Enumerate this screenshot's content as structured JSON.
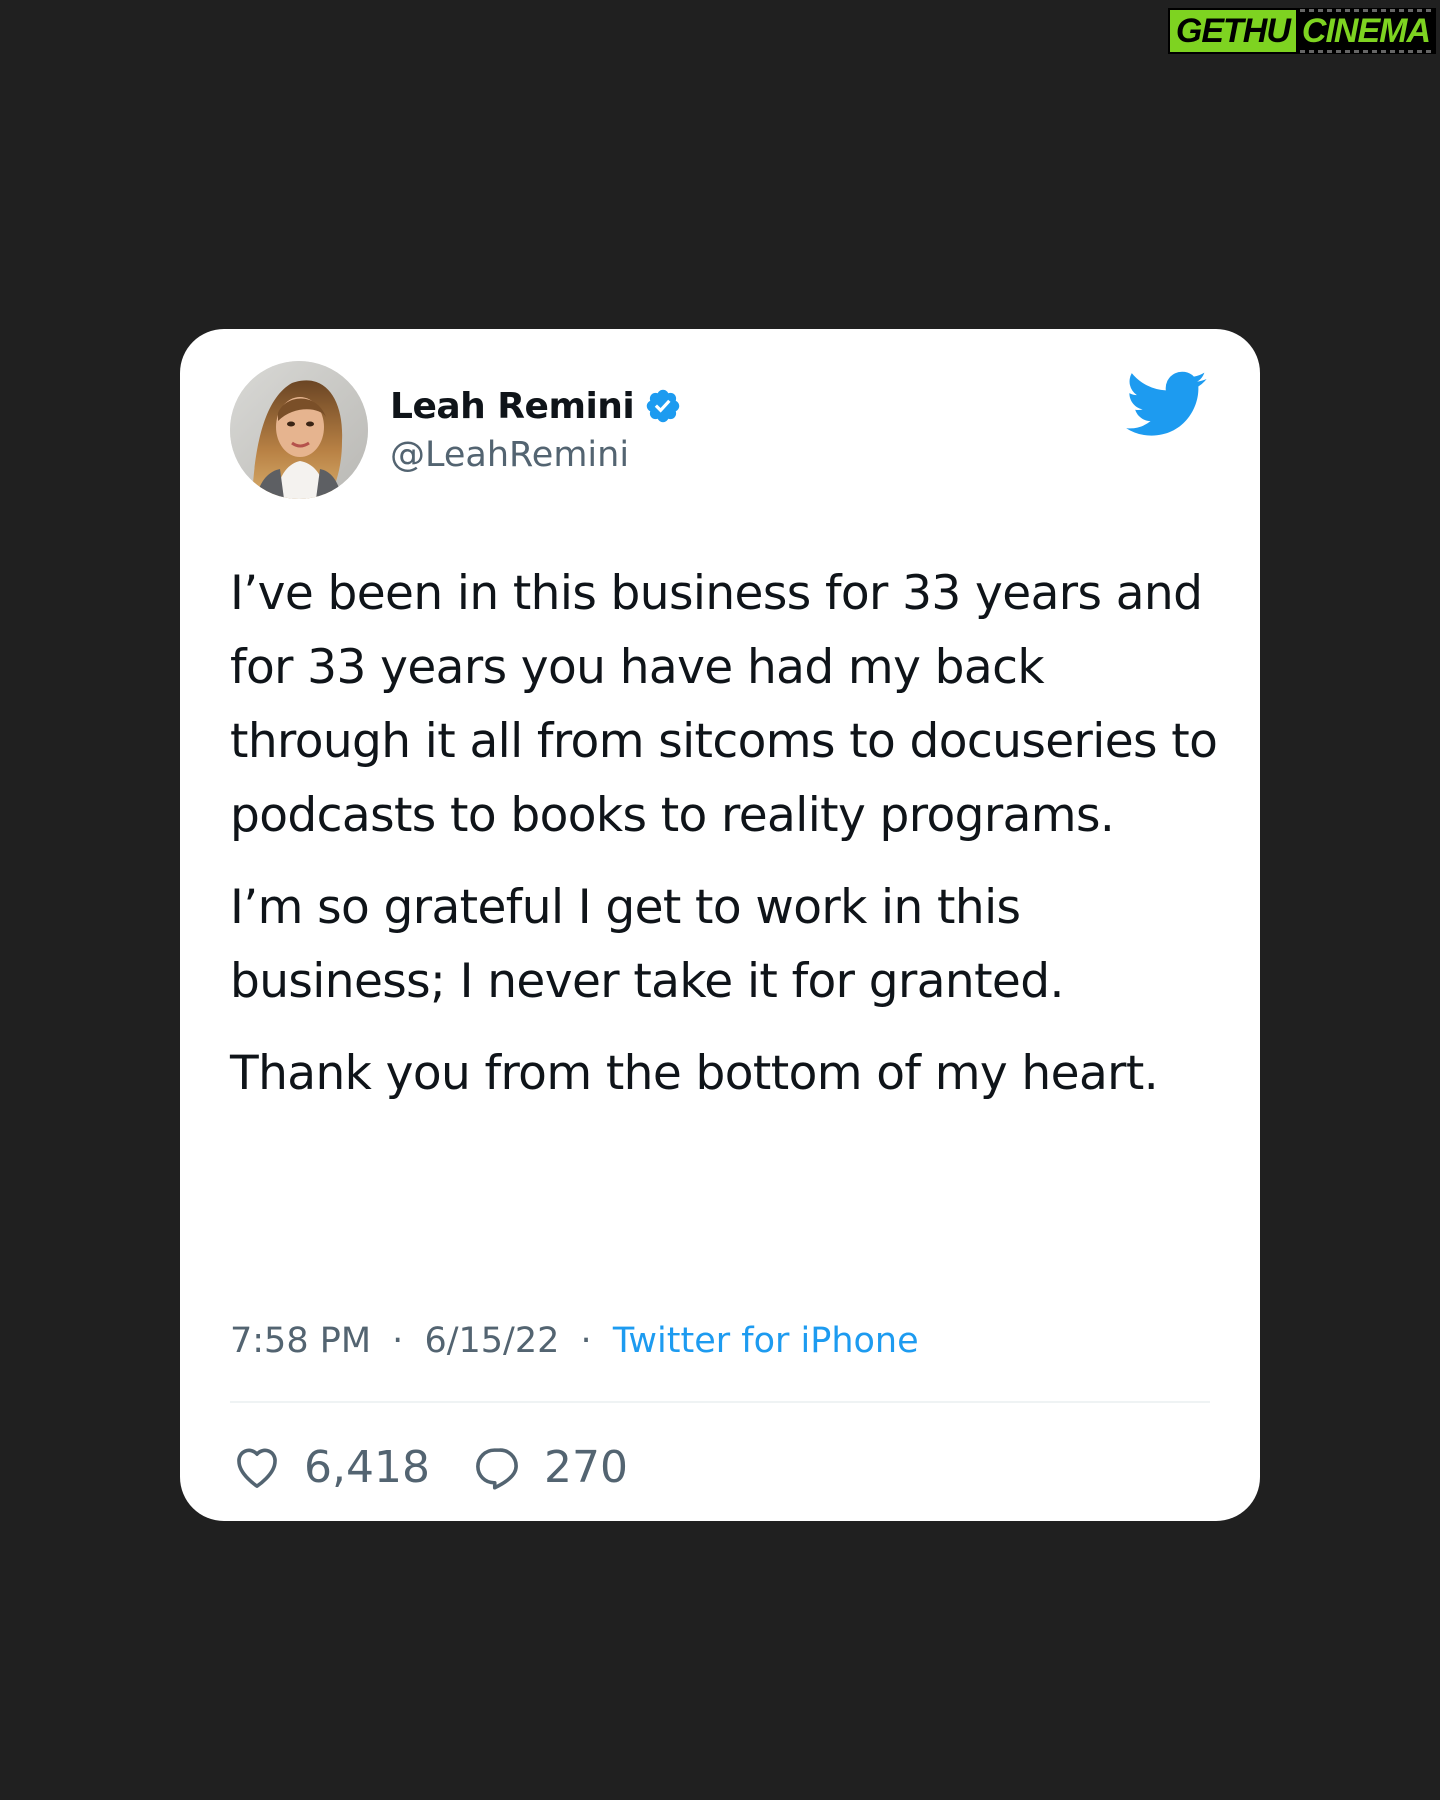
{
  "watermark": {
    "part1": "GETHU",
    "part2": "CINEMA"
  },
  "tweet": {
    "display_name": "Leah Remini",
    "handle": "@LeahRemini",
    "verified": true,
    "body": [
      "I’ve been in this business for 33 years and for 33 years you have had my back through it all from sitcoms to docuseries to podcasts to books to reality programs.",
      "I’m so grateful I get to work in this business; I never take it for granted.",
      "Thank you from the bottom of my heart."
    ],
    "time": "7:58 PM",
    "date": "6/15/22",
    "separator": "·",
    "source": "Twitter for iPhone",
    "likes": "6,418",
    "replies": "270"
  },
  "icons": {
    "verified": "verified-badge-icon",
    "brand": "twitter-bird-icon",
    "likes": "heart-icon",
    "replies": "reply-bubble-icon"
  },
  "colors": {
    "background": "#202020",
    "card": "#ffffff",
    "twitter_blue": "#1d9bf0",
    "secondary_text": "#536471",
    "primary_text": "#0f1419",
    "watermark_green": "#7ED321"
  }
}
